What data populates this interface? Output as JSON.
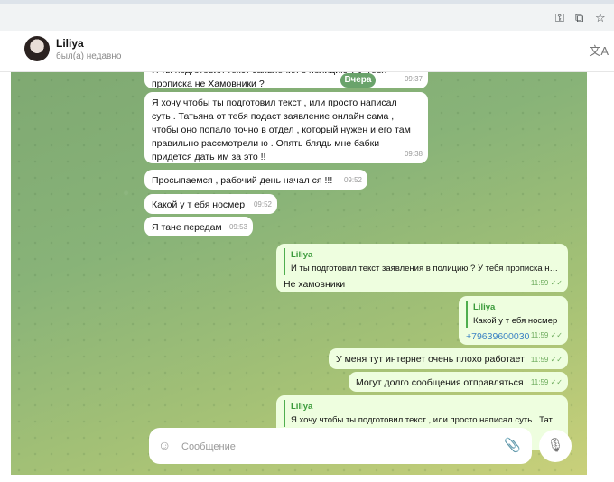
{
  "header": {
    "name": "Liliya",
    "status": "был(а) недавно"
  },
  "date_pill": "Вчера",
  "messages": {
    "m1": {
      "text": "И ты подготовил текст заявления в полицию ? У тебя прописка не Хамовники ?",
      "time": "09:37"
    },
    "m2": {
      "text": "Я хочу чтобы ты подготовил текст , или просто написал суть . Татьяна от тебя подаст заявление онлайн сама , чтобы оно попало точно в отдел , который нужен и его там правильно рассмотрели ю . Опять блядь мне бабки придется дать им за это !!",
      "time": "09:38"
    },
    "m3": {
      "text": "Просыпаемся , рабочий день начал ся !!!",
      "time": "09:52"
    },
    "m4": {
      "text": "Какой у т ебя носмер",
      "time": "09:52"
    },
    "m5": {
      "text": "Я тане передам",
      "time": "09:53"
    },
    "m6": {
      "quote_author": "Liliya",
      "quote_text": "И ты подготовил текст заявления в полицию ? У тебя прописка не...",
      "text": "Не хамовники",
      "time": "11:59"
    },
    "m7": {
      "quote_author": "Liliya",
      "quote_text": "Какой у т ебя носмер",
      "text": "+79639600030",
      "time": "11:59"
    },
    "m8": {
      "text": "У меня тут интернет очень плохо работает",
      "time": "11:59"
    },
    "m9": {
      "text": "Могут долго сообщения отправляться",
      "time": "11:59"
    },
    "m10": {
      "quote_author": "Liliya",
      "quote_text": "Я хочу чтобы ты подготовил текст , или просто написал суть . Тат...",
      "time": ""
    }
  },
  "composer": {
    "placeholder": "Сообщение"
  },
  "icons": [
    "key-icon",
    "cast-icon",
    "star-icon",
    "translate-icon",
    "emoji-icon",
    "paperclip-icon",
    "mic-icon",
    "double-check-icon"
  ],
  "colors": {
    "outgoing_bubble": "#eefedf",
    "incoming_bubble": "#ffffff",
    "quote_bar": "#4fae4e",
    "link": "#3b82c4"
  }
}
